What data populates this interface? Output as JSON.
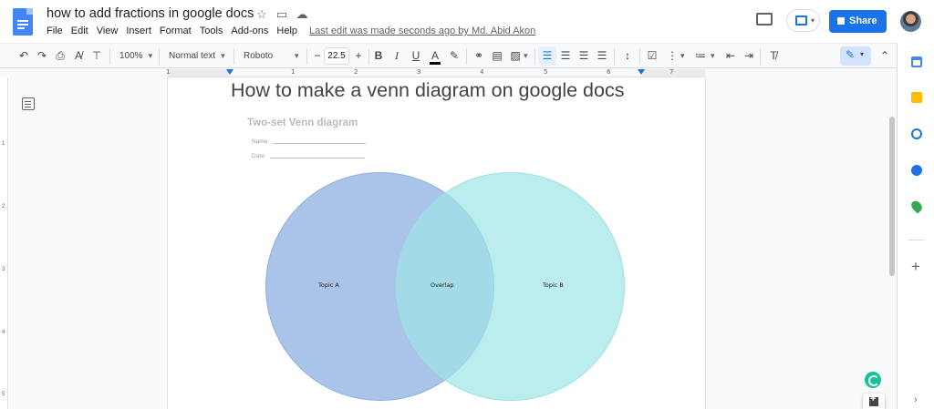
{
  "app": {
    "doc_title": "how to add fractions in google docs",
    "last_edit": "Last edit was made seconds ago by Md. Abid Akon",
    "share_label": "Share"
  },
  "menu": [
    "File",
    "Edit",
    "View",
    "Insert",
    "Format",
    "Tools",
    "Add-ons",
    "Help"
  ],
  "toolbar": {
    "zoom": "100%",
    "style": "Normal text",
    "font": "Roboto",
    "font_size": "22.5",
    "minus": "−",
    "plus": "+",
    "bold": "B",
    "italic": "I",
    "underline": "U",
    "text_color": "A"
  },
  "ruler": {
    "numbers": [
      "1",
      "1",
      "2",
      "3",
      "4",
      "5",
      "6",
      "7"
    ],
    "vertical_numbers": [
      "1",
      "2",
      "3",
      "4",
      "5"
    ]
  },
  "document": {
    "heading": "How to make a venn diagram on google docs",
    "diagram_title": "Two-set Venn diagram",
    "name_label": "Name:",
    "date_label": "Date:",
    "topic_a": "Topic A",
    "overlap": "Overlap",
    "topic_b": "Topic B"
  },
  "colors": {
    "accent": "#1a73e8",
    "circle_a": "#a9c4e8",
    "circle_b": "#a0e6e7"
  },
  "side_panel": {
    "icons": [
      "calendar-icon",
      "keep-icon",
      "tasks-icon",
      "contacts-icon",
      "maps-icon",
      "add-icon"
    ],
    "add": "+",
    "chevron": "›"
  }
}
